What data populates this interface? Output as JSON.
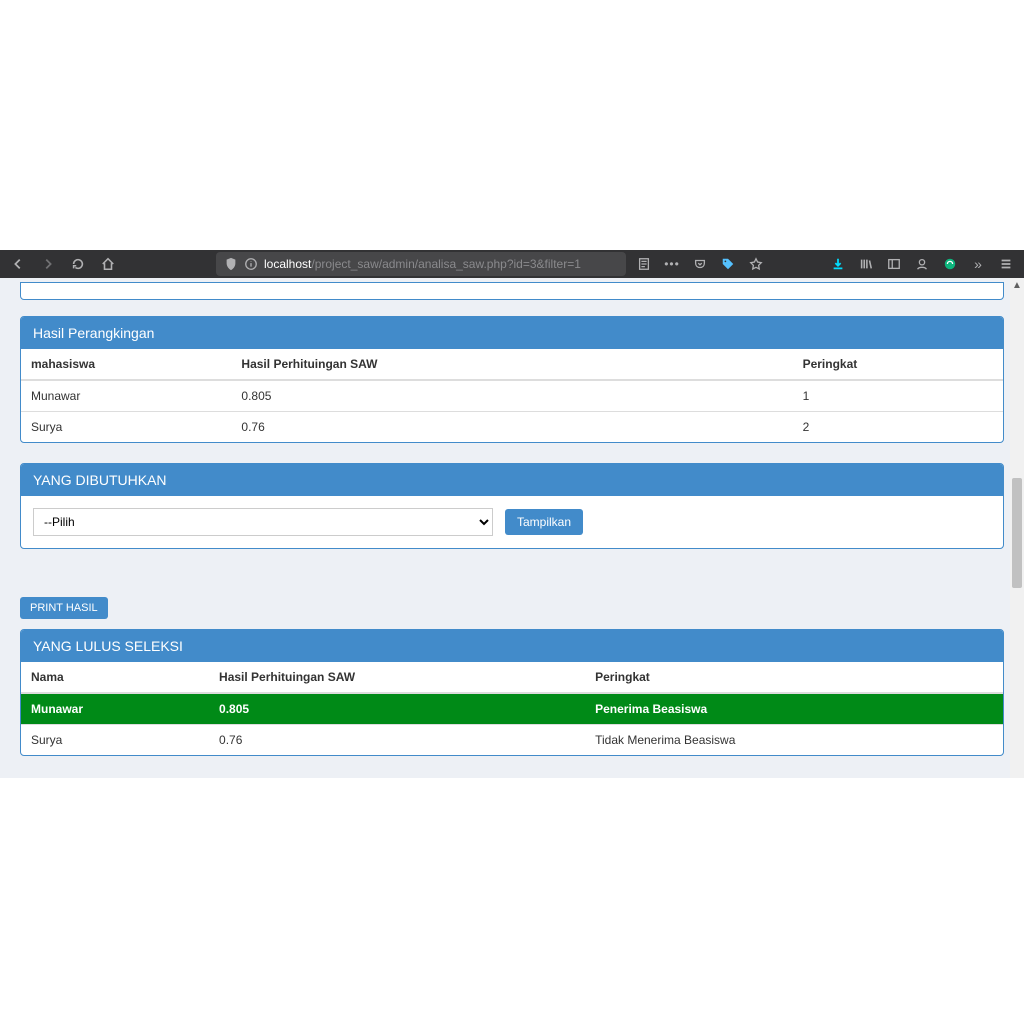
{
  "browser": {
    "url_host": "localhost",
    "url_path": "/project_saw/admin/analisa_saw.php?id=3&filter=1"
  },
  "panels": {
    "ranking": {
      "title": "Hasil Perangkingan",
      "headers": {
        "name": "mahasiswa",
        "saw": "Hasil Perhituingan SAW",
        "rank": "Peringkat"
      },
      "rows": [
        {
          "name": "Munawar",
          "saw": "0.805",
          "rank": "1"
        },
        {
          "name": "Surya",
          "saw": "0.76",
          "rank": "2"
        }
      ]
    },
    "needed": {
      "title": "YANG DIBUTUHKAN",
      "select_placeholder": "--Pilih",
      "show_btn": "Tampilkan"
    },
    "print_btn": "PRINT HASIL",
    "seleksi": {
      "title": "YANG LULUS SELEKSI",
      "headers": {
        "name": "Nama",
        "saw": "Hasil Perhituingan SAW",
        "status": "Peringkat"
      },
      "rows": [
        {
          "name": "Munawar",
          "saw": "0.805",
          "status": "Penerima Beasiswa",
          "pass": true
        },
        {
          "name": "Surya",
          "saw": "0.76",
          "status": "Tidak Menerima Beasiswa",
          "pass": false
        }
      ]
    }
  }
}
